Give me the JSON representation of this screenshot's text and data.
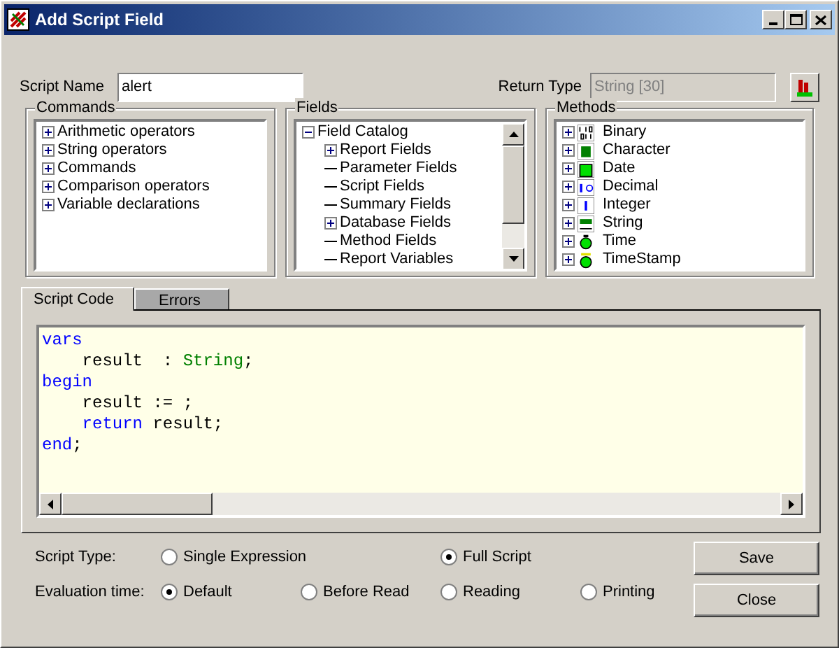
{
  "window": {
    "title": "Add Script Field"
  },
  "script_name": {
    "label": "Script Name",
    "value": "alert"
  },
  "return_type": {
    "label": "Return Type",
    "value": "String [30]",
    "disabled": true
  },
  "commands": {
    "title": "Commands",
    "items": [
      {
        "label": "Arithmetic operators",
        "expanded": false
      },
      {
        "label": "String operators",
        "expanded": false
      },
      {
        "label": "Commands",
        "expanded": false
      },
      {
        "label": "Comparison operators",
        "expanded": false
      },
      {
        "label": "Variable declarations",
        "expanded": false
      }
    ]
  },
  "fields": {
    "title": "Fields",
    "items": [
      {
        "label": "Field Catalog",
        "expanded": true,
        "children": [
          {
            "label": "Report Fields",
            "expanded": false
          },
          {
            "label": "Parameter Fields"
          },
          {
            "label": "Script Fields"
          },
          {
            "label": "Summary Fields"
          },
          {
            "label": "Database Fields",
            "expanded": false
          },
          {
            "label": "Method Fields"
          },
          {
            "label": "Report Variables"
          }
        ]
      }
    ]
  },
  "methods": {
    "title": "Methods",
    "items": [
      {
        "label": "Binary",
        "expanded": false
      },
      {
        "label": "Character",
        "expanded": false
      },
      {
        "label": "Date",
        "expanded": false
      },
      {
        "label": "Decimal",
        "expanded": false
      },
      {
        "label": "Integer",
        "expanded": false
      },
      {
        "label": "String",
        "expanded": false
      },
      {
        "label": "Time",
        "expanded": false
      },
      {
        "label": "TimeStamp",
        "expanded": false
      }
    ]
  },
  "tabs": [
    {
      "label": "Script Code",
      "selected": true
    },
    {
      "label": "Errors",
      "selected": false
    }
  ],
  "code": {
    "lines": [
      [
        {
          "text": "vars",
          "kind": "keyword"
        }
      ],
      [
        {
          "text": "    result  : ",
          "kind": "plain"
        },
        {
          "text": "String",
          "kind": "type"
        },
        {
          "text": ";",
          "kind": "plain"
        }
      ],
      [
        {
          "text": "begin",
          "kind": "keyword"
        }
      ],
      [
        {
          "text": "    result := ;",
          "kind": "plain"
        }
      ],
      [
        {
          "text": "    return",
          "kind": "keyword"
        },
        {
          "text": " result;",
          "kind": "plain"
        }
      ],
      [
        {
          "text": "end",
          "kind": "keyword"
        },
        {
          "text": ";",
          "kind": "plain"
        }
      ]
    ]
  },
  "script_type": {
    "label": "Script Type:",
    "options": [
      {
        "label": "Single Expression",
        "selected": false
      },
      {
        "label": "Full Script",
        "selected": true
      }
    ]
  },
  "evaluation_time": {
    "label": "Evaluation time:",
    "options": [
      {
        "label": "Default",
        "selected": true
      },
      {
        "label": "Before Read",
        "selected": false
      },
      {
        "label": "Reading",
        "selected": false
      },
      {
        "label": "Printing",
        "selected": false
      }
    ]
  },
  "buttons": [
    "Save",
    "Close"
  ]
}
